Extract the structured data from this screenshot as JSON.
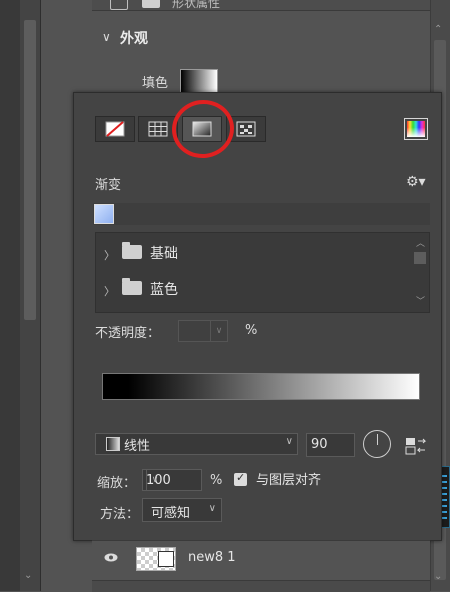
{
  "panel": {
    "top_label": "形状属性",
    "section_title": "外观",
    "fill_label": "填色"
  },
  "popup": {
    "tabs": [
      {
        "name": "no-fill",
        "icon": "no-color-icon"
      },
      {
        "name": "solid-color",
        "icon": "grid-swatch-icon"
      },
      {
        "name": "gradient",
        "icon": "gradient-icon",
        "selected": true
      },
      {
        "name": "pattern",
        "icon": "pattern-icon"
      }
    ],
    "picker_icon": "color-picker-icon",
    "gradient_title": "渐变",
    "gear_icon": "gear-icon",
    "folders": [
      {
        "label": "基础"
      },
      {
        "label": "蓝色"
      }
    ],
    "opacity_label": "不透明度：",
    "opacity_value": "",
    "opacity_unit": "%",
    "gradient_type": "线性",
    "angle_value": "90",
    "scale_label": "缩放：",
    "scale_value": "100",
    "scale_unit": "%",
    "align_label": "与图层对齐",
    "align_checked": true,
    "method_label": "方法：",
    "method_value": "可感知"
  },
  "layer": {
    "name": "new8 1"
  },
  "colors": {
    "annotation_circle": "#e02020",
    "panel_bg": "#535353",
    "popup_bg": "#444444"
  }
}
